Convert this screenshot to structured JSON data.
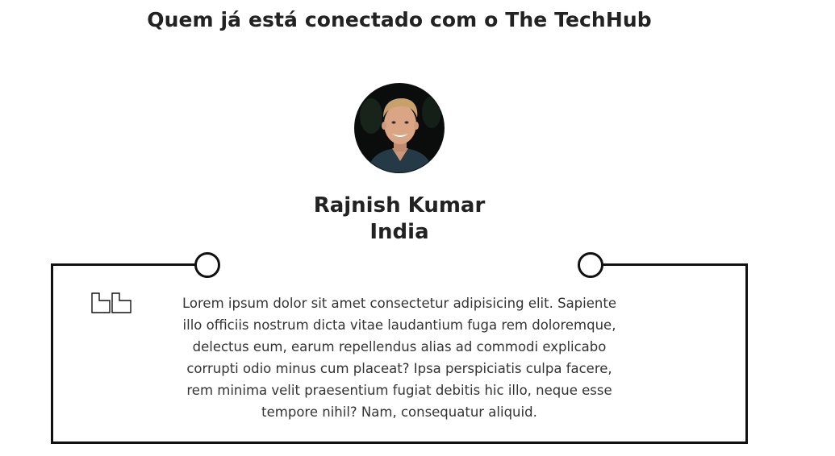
{
  "section": {
    "title": "Quem já está conectado com o The TechHub"
  },
  "testimonial": {
    "name": "Rajnish Kumar",
    "country": "India",
    "quote": "Lorem ipsum dolor sit amet consectetur adipisicing elit. Sapiente illo officiis nostrum dicta vitae laudantium fuga rem doloremque, delectus eum, earum repellendus alias ad commodi explicabo corrupti odio minus cum placeat? Ipsa perspiciatis culpa facere, rem minima velit praesentium fugiat debitis hic illo, neque esse tempore nihil? Nam, consequatur aliquid.",
    "quote_icon": "quote-icon",
    "avatar_icon": "avatar"
  },
  "colors": {
    "text": "#222222",
    "border": "#111111",
    "background": "#ffffff"
  }
}
